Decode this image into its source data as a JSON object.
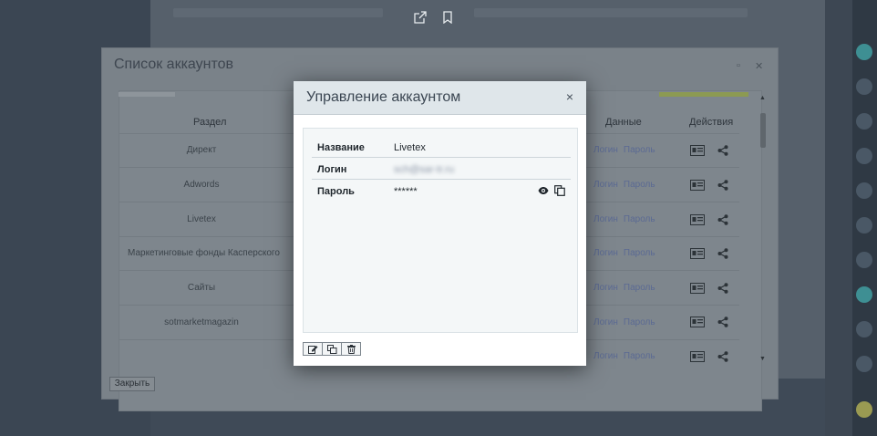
{
  "list_dialog": {
    "title": "Список аккаунтов",
    "columns": {
      "section": "Раздел",
      "data": "Данные",
      "actions": "Действия"
    },
    "rows": [
      {
        "name": "Директ",
        "login": "Логин",
        "password": "Пароль"
      },
      {
        "name": "Adwords",
        "login": "Логин",
        "password": "Пароль"
      },
      {
        "name": "Livetex",
        "login": "Логин",
        "password": "Пароль"
      },
      {
        "name": "Маркетинговые фонды Касперского",
        "login": "Логин",
        "password": "Пароль"
      },
      {
        "name": "Сайты",
        "login": "Логин",
        "password": "Пароль"
      },
      {
        "name": "sotmarketmagazin",
        "login": "Логин",
        "password": "Пароль"
      },
      {
        "name": "",
        "login": "Логин",
        "password": "Пароль"
      }
    ],
    "close_label": "Закрыть"
  },
  "modal": {
    "title": "Управление аккаунтом",
    "close_glyph": "×",
    "fields": {
      "name_label": "Название",
      "name_value": "Livetex",
      "login_label": "Логин",
      "login_value": "sch@sar-tr.ru",
      "password_label": "Пароль",
      "password_value": "******"
    }
  },
  "colors": {
    "overlay": "#3f4a57",
    "modal_header": "#dfe6ea",
    "link": "#5b6a93",
    "accent_bar": "#8c9a52"
  }
}
